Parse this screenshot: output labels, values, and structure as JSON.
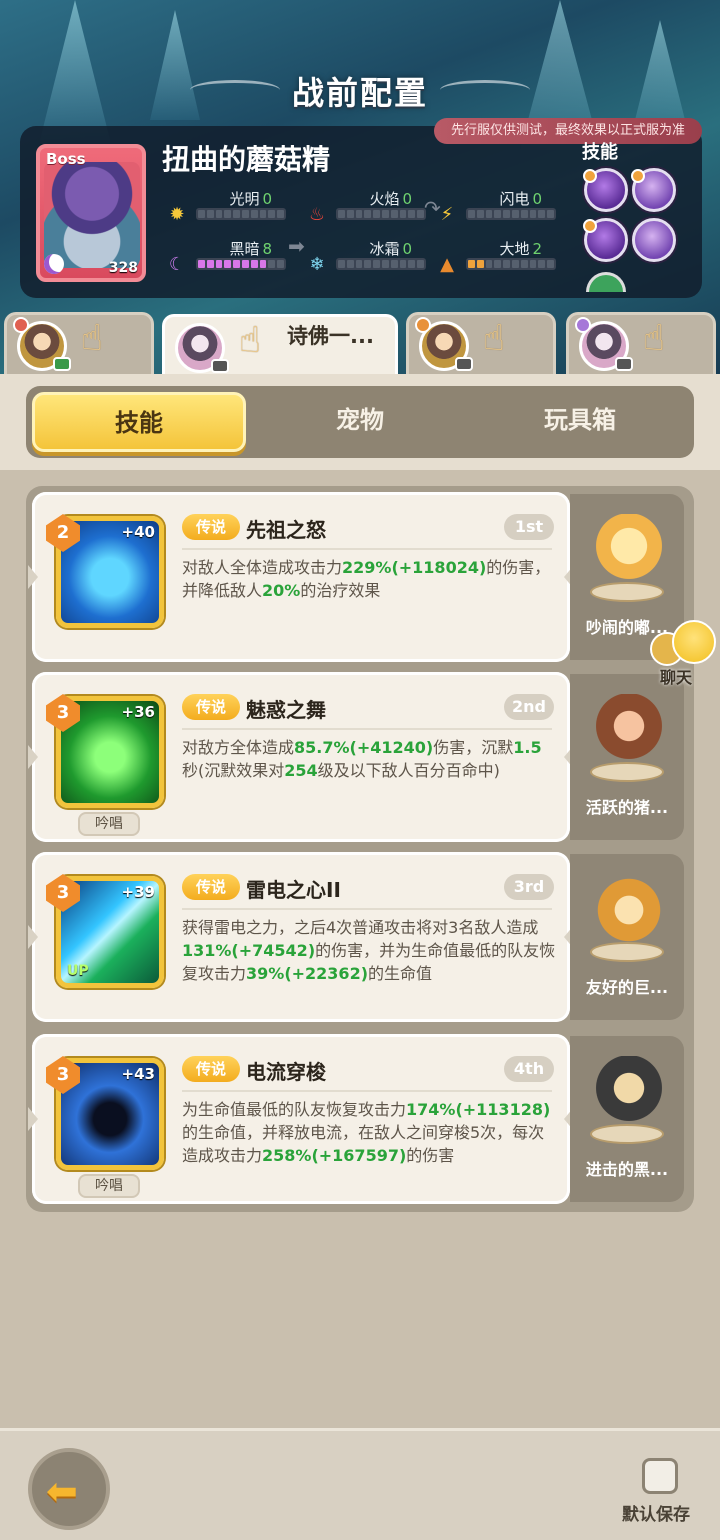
{
  "header": {
    "title": "战前配置",
    "notice": "先行服仅供测试，最终效果以正式服为准"
  },
  "boss": {
    "tag": "Boss",
    "level": "328",
    "name": "扭曲的蘑菇精",
    "elements": [
      {
        "label": "光明",
        "value": "0",
        "icon": "sun-icon",
        "filled": 0
      },
      {
        "label": "火焰",
        "value": "0",
        "icon": "flame-icon",
        "filled": 0
      },
      {
        "label": "闪电",
        "value": "0",
        "icon": "lightning-icon",
        "filled": 0
      },
      {
        "label": "黑暗",
        "value": "8",
        "icon": "moon-icon",
        "filled": 8
      },
      {
        "label": "冰霜",
        "value": "0",
        "icon": "snowflake-icon",
        "filled": 0
      },
      {
        "label": "大地",
        "value": "2",
        "icon": "mountain-icon",
        "filled": 2
      }
    ],
    "skills_label": "技能"
  },
  "heroes": [
    {
      "name": ""
    },
    {
      "name": "诗佛一..."
    },
    {
      "name": ""
    },
    {
      "name": ""
    }
  ],
  "categories": {
    "skill": "技能",
    "pet": "宠物",
    "toybox": "玩具箱"
  },
  "skills": [
    {
      "level": "2",
      "plus": "+40",
      "up": "",
      "chant": "",
      "rarity": "传说",
      "name": "先祖之怒",
      "rank": "1st",
      "desc": [
        "对敌人全体造成攻击力",
        "229%(+118024)",
        "的伤害，并降低敌人",
        "20%",
        "的治疗效果"
      ]
    },
    {
      "level": "3",
      "plus": "+36",
      "up": "",
      "chant": "吟唱",
      "rarity": "传说",
      "name": "魅惑之舞",
      "rank": "2nd",
      "desc": [
        "对敌方全体造成",
        "85.7%(+41240)",
        "伤害，沉默",
        "1.5",
        "秒(沉默效果对",
        "254",
        "级及以下敌人百分百命中)"
      ]
    },
    {
      "level": "3",
      "plus": "+39",
      "up": "UP",
      "chant": "",
      "rarity": "传说",
      "name": "雷电之心II",
      "rank": "3rd",
      "desc": [
        "获得雷电之力，之后4次普通攻击将对3名敌人造成",
        "131%(+74542)",
        "的伤害，并为生命值最低的队友恢复攻击力",
        "39%(+22362)",
        "的生命值"
      ]
    },
    {
      "level": "3",
      "plus": "+43",
      "up": "",
      "chant": "吟唱",
      "rarity": "传说",
      "name": "电流穿梭",
      "rank": "4th",
      "desc": [
        "为生命值最低的队友恢复攻击力",
        "174%(+113128)",
        "的生命值，并释放电流，在敌人之间穿梭5次，每次造成攻击力",
        "258%(+167597)",
        "的伤害"
      ]
    }
  ],
  "pets": [
    {
      "name": "吵闹的嘟..."
    },
    {
      "name": "活跃的猪..."
    },
    {
      "name": "友好的巨..."
    },
    {
      "name": "进击的黑..."
    }
  ],
  "chat": {
    "label": "聊天"
  },
  "footer": {
    "save_label": "默认保存",
    "save_checked": false
  },
  "colors": {
    "legend": "#f3ac1e",
    "highlight": "#2aa33a",
    "tab_active": "#f4c43a"
  }
}
